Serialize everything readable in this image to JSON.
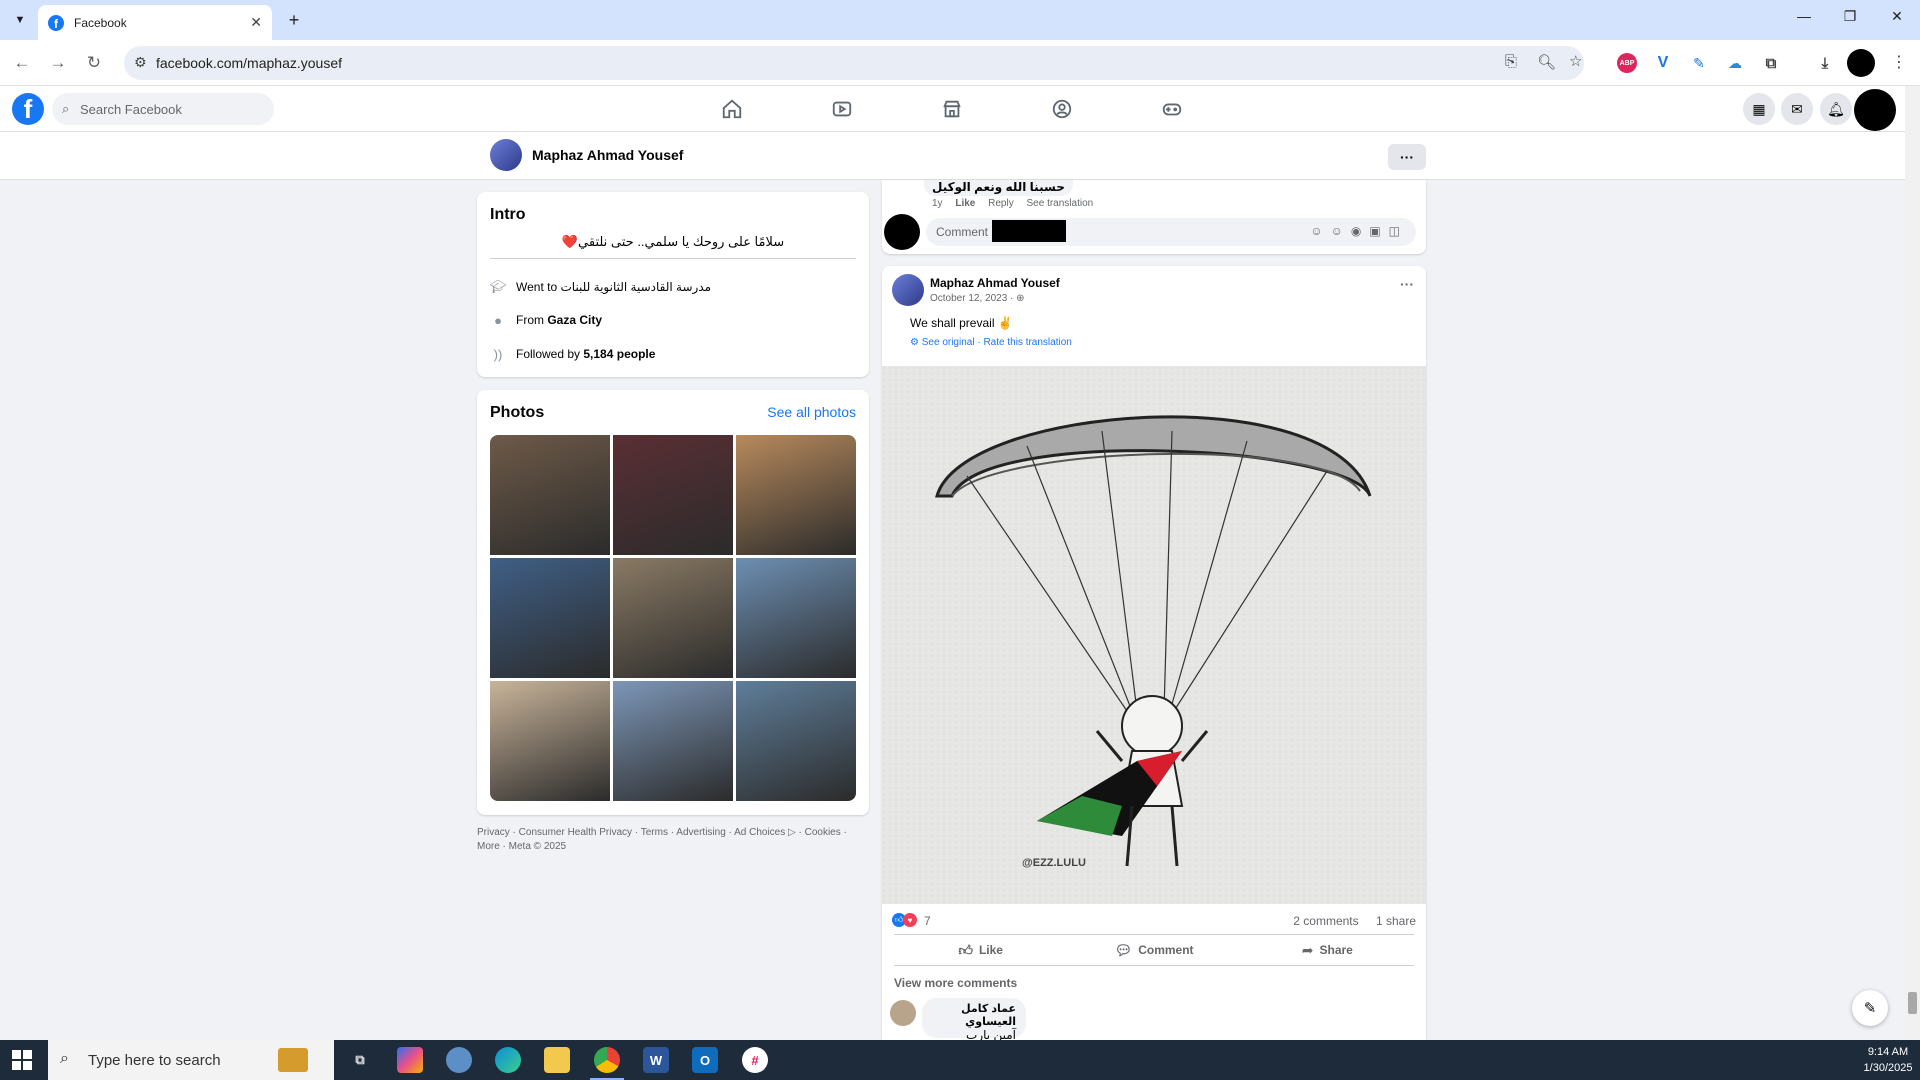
{
  "browser": {
    "tab_title": "Facebook",
    "url": "facebook.com/maphaz.yousef",
    "ext_abp": "ABP",
    "ext_v": "V"
  },
  "fb": {
    "search_placeholder": "Search Facebook",
    "logo_letter": "f"
  },
  "profile": {
    "name": "Maphaz Ahmad Yousef",
    "more_label": "···"
  },
  "intro": {
    "title": "Intro",
    "bio": "سلامًا على روحك يا سلمي.. حتى نلتقي❤️",
    "went_to_prefix": "Went to",
    "school": "مدرسة القادسية الثانوية للبنات",
    "from_prefix": "From",
    "city": "Gaza City",
    "followed_prefix": "Followed by",
    "followers": "5,184 people"
  },
  "photos": {
    "title": "Photos",
    "see_all": "See all photos",
    "tiles": [
      {
        "color": "#6e5a48"
      },
      {
        "color": "#5a2f34"
      },
      {
        "color": "#b88a5c"
      },
      {
        "color": "#3f5f86"
      },
      {
        "color": "#8a7a64"
      },
      {
        "color": "#6d8fb3"
      },
      {
        "color": "#c9b49a"
      },
      {
        "color": "#7d97b8"
      },
      {
        "color": "#5f7e9a"
      }
    ]
  },
  "footer": {
    "line1": "Privacy · Consumer Health Privacy · Terms · Advertising · Ad Choices ▷ · Cookies ·",
    "line2": "More · Meta © 2025"
  },
  "prev_comment": {
    "text": "حسبنا الله ونعم الوكيل",
    "age": "1y",
    "like": "Like",
    "reply": "Reply",
    "see_translation": "See translation",
    "input_placeholder": "Comment as"
  },
  "post": {
    "author": "Maphaz Ahmad Yousef",
    "date": "October 12, 2023 · ",
    "text": "We shall prevail ✌️",
    "see_original": "See original",
    "rate_translation": "Rate this translation",
    "artist_tag": "@EZZ.LULU",
    "reaction_count": "7",
    "comments_count": "2 comments",
    "shares_count": "1 share",
    "like_label": "Like",
    "comment_label": "Comment",
    "share_label": "Share",
    "view_more": "View more comments",
    "comment2_author": "عماد كامل العيساوي",
    "comment2_text": "آمين يارب"
  },
  "taskbar": {
    "search_text": "Type here to search",
    "time": "9:14 AM",
    "date": "1/30/2025"
  }
}
